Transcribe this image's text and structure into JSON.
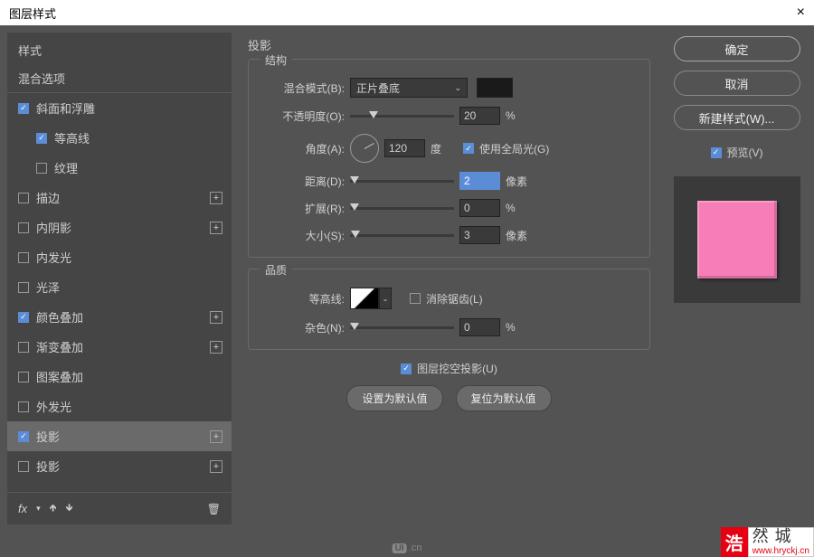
{
  "dialog": {
    "title": "图层样式"
  },
  "left": {
    "styles_header": "样式",
    "blend_options": "混合选项",
    "items": [
      {
        "label": "斜面和浮雕",
        "checked": true,
        "indent": false,
        "plus": false
      },
      {
        "label": "等高线",
        "checked": true,
        "indent": true,
        "plus": false
      },
      {
        "label": "纹理",
        "checked": false,
        "indent": true,
        "plus": false
      },
      {
        "label": "描边",
        "checked": false,
        "indent": false,
        "plus": true
      },
      {
        "label": "内阴影",
        "checked": false,
        "indent": false,
        "plus": true
      },
      {
        "label": "内发光",
        "checked": false,
        "indent": false,
        "plus": false
      },
      {
        "label": "光泽",
        "checked": false,
        "indent": false,
        "plus": false
      },
      {
        "label": "颜色叠加",
        "checked": true,
        "indent": false,
        "plus": true
      },
      {
        "label": "渐变叠加",
        "checked": false,
        "indent": false,
        "plus": true
      },
      {
        "label": "图案叠加",
        "checked": false,
        "indent": false,
        "plus": false
      },
      {
        "label": "外发光",
        "checked": false,
        "indent": false,
        "plus": false
      },
      {
        "label": "投影",
        "checked": true,
        "indent": false,
        "plus": true,
        "selected": true
      },
      {
        "label": "投影",
        "checked": false,
        "indent": false,
        "plus": true
      }
    ],
    "fx": "fx"
  },
  "mid": {
    "section": "投影",
    "structure": {
      "title": "结构",
      "blend_mode": {
        "label": "混合模式(B):",
        "value": "正片叠底"
      },
      "opacity": {
        "label": "不透明度(O):",
        "value": "20",
        "unit": "%"
      },
      "angle": {
        "label": "角度(A):",
        "value": "120",
        "unit": "度",
        "global_label": "使用全局光(G)"
      },
      "distance": {
        "label": "距离(D):",
        "value": "2",
        "unit": "像素"
      },
      "spread": {
        "label": "扩展(R):",
        "value": "0",
        "unit": "%"
      },
      "size": {
        "label": "大小(S):",
        "value": "3",
        "unit": "像素"
      }
    },
    "quality": {
      "title": "品质",
      "contour": {
        "label": "等高线:",
        "antialias": "消除锯齿(L)"
      },
      "noise": {
        "label": "杂色(N):",
        "value": "0",
        "unit": "%"
      }
    },
    "knockout": "图层挖空投影(U)",
    "set_default": "设置为默认值",
    "reset_default": "复位为默认值"
  },
  "right": {
    "ok": "确定",
    "cancel": "取消",
    "new_style": "新建样式(W)...",
    "preview": "预览(V)"
  },
  "watermark": {
    "char": "浩",
    "zh": "然  城",
    "url": "www.hryckj.cn"
  },
  "uicn": ".cn"
}
